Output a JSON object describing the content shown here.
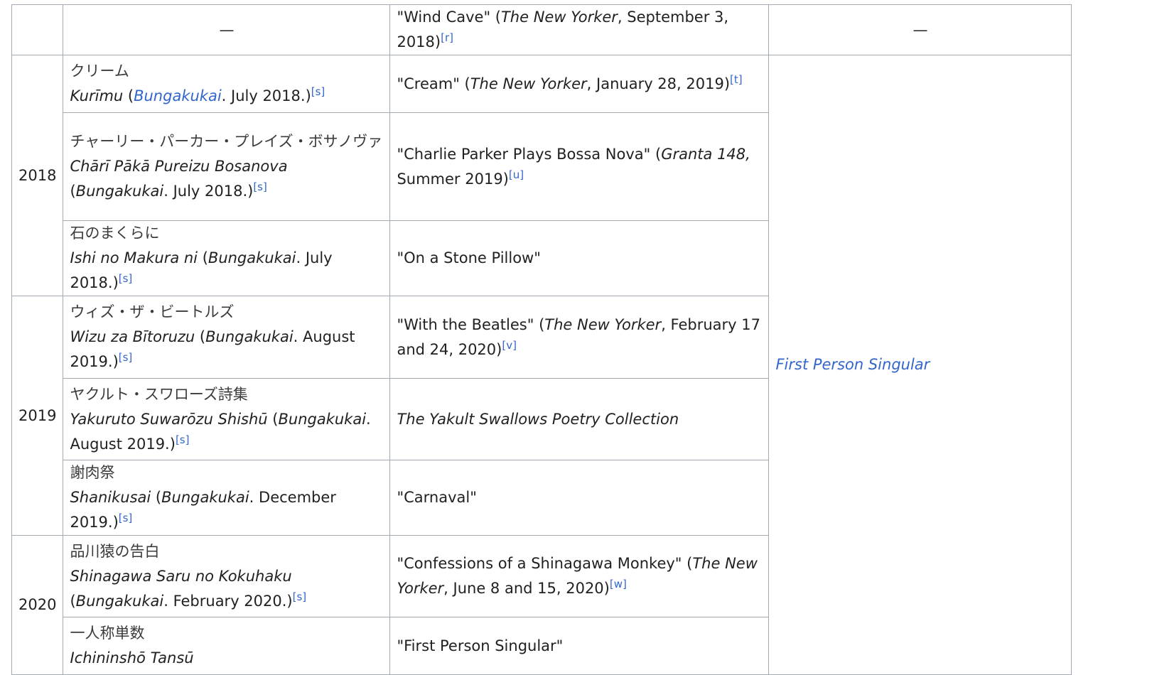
{
  "table": {
    "dash": "—",
    "rows": [
      {
        "english_pre": "\"Wind Cave\" (",
        "english_mag": "The New Yorker",
        "english_post": ", September 3, 2018)",
        "english_ref": "[r]"
      },
      {
        "jp": "クリーム",
        "romaji": "Kurīmu",
        "pub_link": "Bungakukai",
        "pub_date": ". July 2018.)",
        "pub_ref": "[s]",
        "english_pre": "\"Cream\" (",
        "english_mag": "The New Yorker",
        "english_post": ", January 28, 2019)",
        "english_ref": "[t]"
      },
      {
        "jp": "チャーリー・パーカー・プレイズ・ボサノヴァ",
        "romaji": "Chārī Pākā Pureizu Bosanova",
        "pub_link": "Bungakukai",
        "pub_date": ". July 2018.)",
        "pub_ref": "[s]",
        "english_pre": "\"Charlie Parker Plays Bossa Nova\" (",
        "english_mag": "Granta 148,",
        "english_post": " Summer 2019)",
        "english_ref": "[u]"
      },
      {
        "jp": "石のまくらに",
        "romaji": "Ishi no Makura ni",
        "pub_link": "Bungakukai",
        "pub_date": ". July 2018.)",
        "pub_ref": "[s]",
        "english_plain": "\"On a Stone Pillow\""
      },
      {
        "jp": "ウィズ・ザ・ビートルズ",
        "romaji": "Wizu za Bītoruzu",
        "pub_link": "Bungakukai",
        "pub_date": ". August 2019.)",
        "pub_ref": "[s]",
        "english_pre": "\"With the Beatles\" (",
        "english_mag": "The New Yorker",
        "english_post": ", February 17 and 24, 2020)",
        "english_ref": "[v]"
      },
      {
        "jp": "ヤクルト・スワローズ詩集",
        "romaji": "Yakuruto Suwarōzu Shishū",
        "pub_link": "Bungakukai",
        "pub_date": ". August 2019.)",
        "pub_ref": "[s]",
        "english_italic": "The Yakult Swallows Poetry Collection"
      },
      {
        "jp": "謝肉祭",
        "romaji": "Shanikusai",
        "pub_link": "Bungakukai",
        "pub_date": ". December 2019.)",
        "pub_ref": "[s]",
        "english_plain": "\"Carnaval\""
      },
      {
        "jp": "品川猿の告白",
        "romaji": "Shinagawa Saru no Kokuhaku",
        "pub_link": "Bungakukai",
        "pub_date": ". February 2020.)",
        "pub_ref": "[s]",
        "english_pre": "\"Confessions of a Shinagawa Monkey\" (",
        "english_mag": "The New Yorker",
        "english_post": ", June 8 and 15, 2020)",
        "english_ref": "[w]"
      },
      {
        "jp": "一人称単数",
        "romaji": "Ichininshō Tansū",
        "english_plain": "\"First Person Singular\""
      }
    ],
    "years": {
      "y2018": "2018",
      "y2019": "2019",
      "y2020": "2020"
    },
    "book_title": "First Person Singular"
  },
  "colors": {
    "border": "#a2a9b1",
    "link": "#3366cc",
    "text": "#202122"
  }
}
